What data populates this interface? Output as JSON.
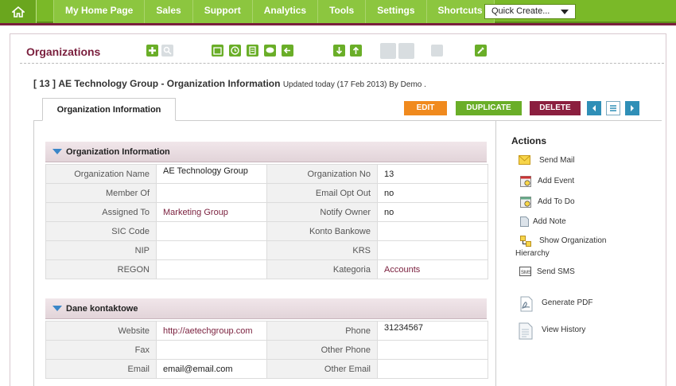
{
  "nav": {
    "items": [
      "My Home Page",
      "Sales",
      "Support",
      "Analytics",
      "Tools",
      "Settings",
      "Shortcuts"
    ],
    "quick_create": "Quick Create..."
  },
  "module": {
    "title": "Organizations"
  },
  "record": {
    "id_label": "[ 13 ]",
    "title": "AE Technology Group - Organization Information",
    "updated": "Updated today (17 Feb 2013) By Demo ."
  },
  "tabs": {
    "active": "Organization Information"
  },
  "buttons": {
    "edit": "EDIT",
    "duplicate": "DUPLICATE",
    "delete": "DELETE"
  },
  "sections": {
    "org_info": {
      "title": "Organization Information",
      "rows": [
        {
          "l1": "Organization Name",
          "v1": "AE Technology Group",
          "l2": "Organization No",
          "v2": "13"
        },
        {
          "l1": "Member Of",
          "v1": "",
          "l2": "Email Opt Out",
          "v2": "no"
        },
        {
          "l1": "Assigned To",
          "v1": "Marketing Group",
          "l2": "Notify Owner",
          "v2": "no"
        },
        {
          "l1": "SIC Code",
          "v1": "",
          "l2": "Konto Bankowe",
          "v2": ""
        },
        {
          "l1": "NIP",
          "v1": "",
          "l2": "KRS",
          "v2": ""
        },
        {
          "l1": "REGON",
          "v1": "",
          "l2": "Kategoria",
          "v2": "Accounts"
        }
      ]
    },
    "contact": {
      "title": "Dane kontaktowe",
      "rows": [
        {
          "l1": "Website",
          "v1": "http://aetechgroup.com",
          "l2": "Phone",
          "v2": "31234567"
        },
        {
          "l1": "Fax",
          "v1": "",
          "l2": "Other Phone",
          "v2": ""
        },
        {
          "l1": "Email",
          "v1": "email@email.com",
          "l2": "Other Email",
          "v2": ""
        }
      ]
    }
  },
  "actions": {
    "title": "Actions",
    "send_mail": "Send Mail",
    "add_event": "Add Event",
    "add_todo": "Add To Do",
    "add_note": "Add Note",
    "show_hierarchy_1": "Show Organization",
    "show_hierarchy_2": "Hierarchy",
    "send_sms": "Send SMS",
    "generate_pdf": "Generate PDF",
    "view_history": "View History"
  },
  "colors": {
    "nav_green": "#8cc63f",
    "brand_maroon": "#7a1f3d",
    "edit_orange": "#f08a1e",
    "dup_green": "#6aae28",
    "delete_maroon": "#8b1f3f"
  }
}
